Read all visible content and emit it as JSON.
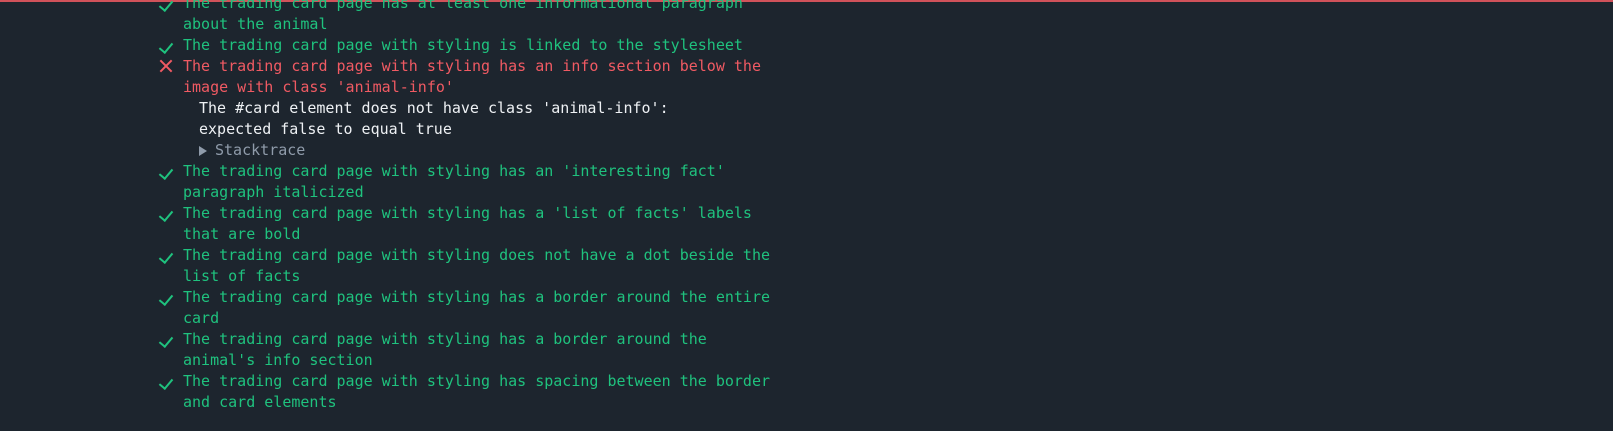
{
  "tests": [
    {
      "status": "pass",
      "title": "The trading card page has at least one informational paragraph about the animal"
    },
    {
      "status": "pass",
      "title": "The trading card page with styling is linked to the stylesheet"
    },
    {
      "status": "fail",
      "title": "The trading card page with styling has an info section below the image with class 'animal-info'"
    },
    {
      "status": "pass",
      "title": "The trading card page with styling has an 'interesting fact' paragraph italicized"
    },
    {
      "status": "pass",
      "title": "The trading card page with styling has a 'list of facts' labels that are bold"
    },
    {
      "status": "pass",
      "title": "The trading card page with styling does not have a dot beside the list of facts"
    },
    {
      "status": "pass",
      "title": "The trading card page with styling has a border around the entire card"
    },
    {
      "status": "pass",
      "title": "The trading card page with styling has a border around the animal's info section"
    },
    {
      "status": "pass",
      "title": "The trading card page with styling has spacing between the border and card elements"
    }
  ],
  "error": {
    "message": "The #card element does not have class 'animal-info': expected false to equal true",
    "stacktrace_label": "Stacktrace"
  },
  "colors": {
    "background": "#1d252e",
    "pass": "#1fc27e",
    "fail": "#f05a63",
    "error_text": "#eef1f4",
    "muted": "#8f9baa",
    "top_rule": "#d1525a"
  },
  "icons": {
    "pass": "check-icon",
    "fail": "cross-icon",
    "stacktrace": "triangle-right-icon"
  }
}
